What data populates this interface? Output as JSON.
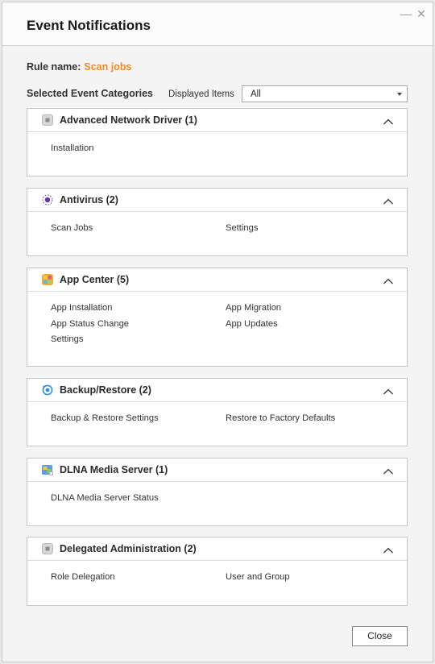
{
  "dialog": {
    "title": "Event Notifications",
    "minimize_symbol": "—",
    "close_symbol": "✕"
  },
  "rule": {
    "label": "Rule name:",
    "value": "Scan jobs"
  },
  "categories_label": "Selected Event Categories",
  "displayed_items": {
    "label": "Displayed Items",
    "value": "All"
  },
  "panels": [
    {
      "title": "Advanced Network Driver (1)",
      "icon": "network-driver-icon",
      "items": [
        "Installation"
      ]
    },
    {
      "title": "Antivirus (2)",
      "icon": "antivirus-icon",
      "items": [
        "Scan Jobs",
        "Settings"
      ]
    },
    {
      "title": "App Center (5)",
      "icon": "app-center-icon",
      "items": [
        "App Installation",
        "App Migration",
        "App Status Change",
        "App Updates",
        "Settings"
      ]
    },
    {
      "title": "Backup/Restore (2)",
      "icon": "backup-restore-icon",
      "items": [
        "Backup & Restore Settings",
        "Restore to Factory Defaults"
      ]
    },
    {
      "title": "DLNA Media Server (1)",
      "icon": "dlna-media-server-icon",
      "items": [
        "DLNA Media Server Status"
      ]
    },
    {
      "title": "Delegated Administration (2)",
      "icon": "delegated-administration-icon",
      "items": [
        "Role Delegation",
        "User and Group"
      ]
    }
  ],
  "close_label": "Close"
}
